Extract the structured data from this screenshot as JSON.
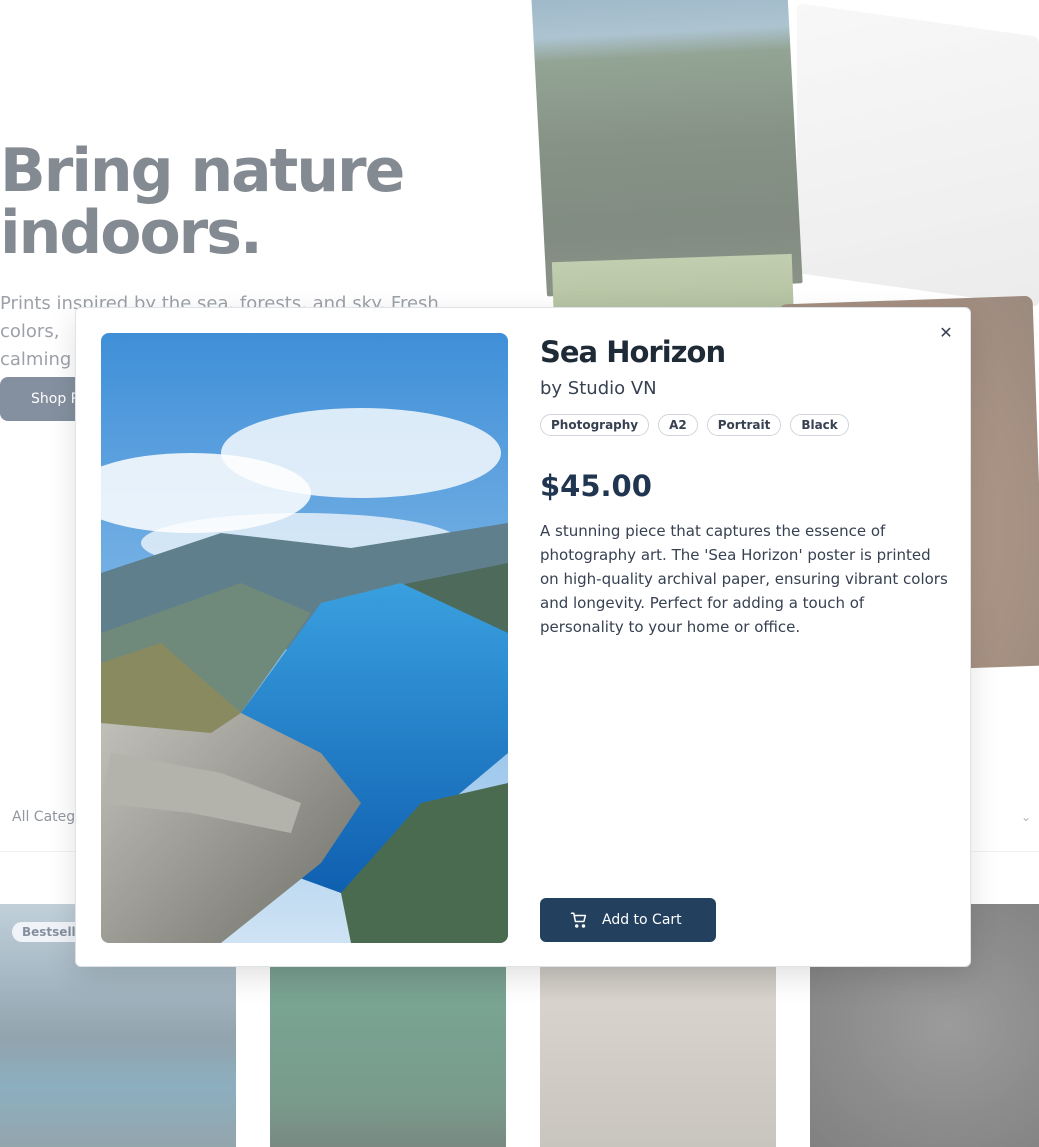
{
  "hero": {
    "title_line1": "Bring nature",
    "title_line2": "indoors.",
    "subtitle_line1": "Prints inspired by the sea, forests, and sky. Fresh colors,",
    "subtitle_line2": "calming",
    "cta_label": "Shop P"
  },
  "filters": {
    "category_label": "All Categ",
    "chevron": "chevron-down-icon"
  },
  "cards": {
    "first_badge": "Bestselle"
  },
  "modal": {
    "close_icon": "close-icon",
    "title": "Sea Horizon",
    "artist": "by Studio VN",
    "tags": [
      "Photography",
      "A2",
      "Portrait",
      "Black"
    ],
    "price": "$45.00",
    "description": "A stunning piece that captures the essence of photography art. The 'Sea Horizon' poster is printed on high-quality archival paper, ensuring vibrant colors and longevity. Perfect for adding a touch of personality to your home or office.",
    "add_to_cart_label": "Add to Cart",
    "cart_icon": "cart-icon"
  },
  "colors": {
    "primary": "#23405e",
    "text": "#1f2a37"
  }
}
